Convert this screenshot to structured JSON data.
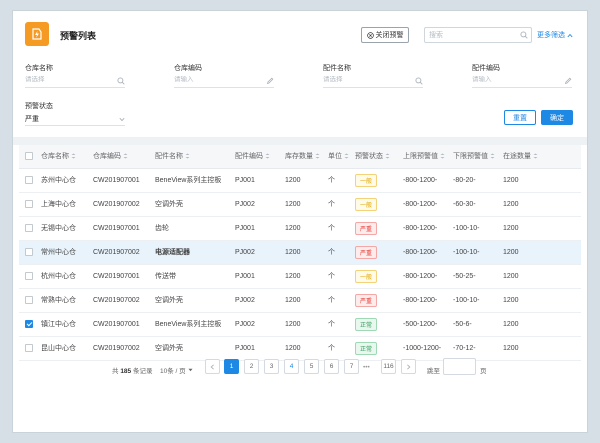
{
  "header": {
    "title": "预警列表",
    "close_label": "关闭预警",
    "search_placeholder": "搜索",
    "more_filters": "更多筛选"
  },
  "filters": [
    {
      "label": "仓库名称",
      "placeholder": "请选择"
    },
    {
      "label": "仓库编码",
      "placeholder": "请输入"
    },
    {
      "label": "配件名称",
      "placeholder": "请选择"
    },
    {
      "label": "配件编码",
      "placeholder": "请输入"
    }
  ],
  "status_filter": {
    "label": "预警状态",
    "value": "严重"
  },
  "buttons": {
    "reset": "重置",
    "confirm": "确定"
  },
  "table": {
    "headers": [
      "仓库名称",
      "仓库编码",
      "配件名称",
      "配件编码",
      "库存数量",
      "单位",
      "预警状态",
      "上限预警值",
      "下限预警值",
      "在途数量"
    ],
    "rows": [
      {
        "warehouse": "苏州中心仓",
        "code": "CW201907001",
        "part": "BeneView系列主控板",
        "part_code": "PJ001",
        "qty": "1200",
        "unit": "个",
        "status": "一般",
        "level": "general",
        "upper": "-800-1200-",
        "lower": "-80-20-",
        "transit": "1200",
        "checked": false,
        "highlight": false
      },
      {
        "warehouse": "上海中心仓",
        "code": "CW201907002",
        "part": "空调外壳",
        "part_code": "PJ002",
        "qty": "1200",
        "unit": "个",
        "status": "一般",
        "level": "general",
        "upper": "-800-1200-",
        "lower": "-60-30-",
        "transit": "1200",
        "checked": false,
        "highlight": false
      },
      {
        "warehouse": "无锡中心仓",
        "code": "CW201907001",
        "part": "齿轮",
        "part_code": "PJ001",
        "qty": "1200",
        "unit": "个",
        "status": "严重",
        "level": "severe",
        "upper": "-800-1200-",
        "lower": "-100-10-",
        "transit": "1200",
        "checked": false,
        "highlight": false
      },
      {
        "warehouse": "常州中心仓",
        "code": "CW201907002",
        "part": "电源适配器",
        "part_code": "PJ002",
        "qty": "1200",
        "unit": "个",
        "status": "严重",
        "level": "severe",
        "upper": "-800-1200-",
        "lower": "-100-10-",
        "transit": "1200",
        "checked": false,
        "highlight": true
      },
      {
        "warehouse": "杭州中心仓",
        "code": "CW201907001",
        "part": "传送带",
        "part_code": "PJ001",
        "qty": "1200",
        "unit": "个",
        "status": "一般",
        "level": "general",
        "upper": "-800-1200-",
        "lower": "-50-25-",
        "transit": "1200",
        "checked": false,
        "highlight": false
      },
      {
        "warehouse": "常熟中心仓",
        "code": "CW201907002",
        "part": "空调外壳",
        "part_code": "PJ002",
        "qty": "1200",
        "unit": "个",
        "status": "严重",
        "level": "severe",
        "upper": "-800-1200-",
        "lower": "-100-10-",
        "transit": "1200",
        "checked": false,
        "highlight": false
      },
      {
        "warehouse": "镇江中心仓",
        "code": "CW201907001",
        "part": "BeneView系列主控板",
        "part_code": "PJ002",
        "qty": "1200",
        "unit": "个",
        "status": "正常",
        "level": "normal",
        "upper": "-500-1200-",
        "lower": "-50-6-",
        "transit": "1200",
        "checked": true,
        "highlight": false
      },
      {
        "warehouse": "昆山中心仓",
        "code": "CW201907002",
        "part": "空调外壳",
        "part_code": "PJ001",
        "qty": "1200",
        "unit": "个",
        "status": "正常",
        "level": "normal",
        "upper": "-1000-1200-",
        "lower": "-70-12-",
        "transit": "1200",
        "checked": false,
        "highlight": false
      }
    ]
  },
  "pagination": {
    "total_prefix": "共",
    "total": "185",
    "total_suffix": "条记录",
    "page_size": "10条 / 页",
    "pages": [
      "1",
      "2",
      "3",
      "4",
      "5",
      "6",
      "7"
    ],
    "ellipsis": "•••",
    "last": "116",
    "jump_label": "跳至",
    "jump_suffix": "页"
  },
  "colors": {
    "accent": "#1e88e5",
    "logo": "#f59a23"
  }
}
